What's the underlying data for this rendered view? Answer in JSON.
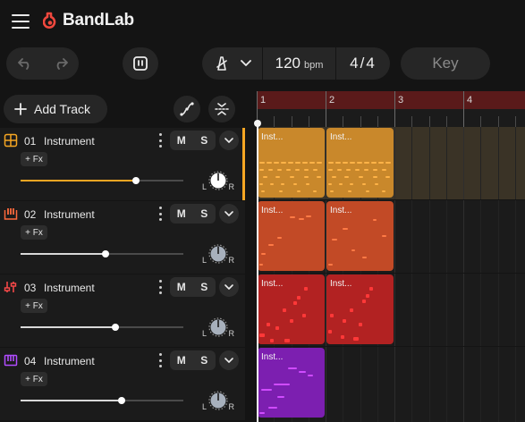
{
  "app": {
    "brand": "BandLab"
  },
  "toolbar": {
    "bpm_value": "120",
    "bpm_unit": "bpm",
    "time_signature": "4/4",
    "key_label": "Key",
    "add_track_label": "Add Track"
  },
  "ruler": {
    "bars": [
      "1",
      "2",
      "3",
      "4"
    ]
  },
  "tracks": [
    {
      "number": "01",
      "name": "Instrument",
      "mute": "M",
      "solo": "S",
      "fx": "+ Fx",
      "pan_left": "L",
      "pan_right": "R",
      "volume": 0.71,
      "color": "#f6a623",
      "icon": "drum-pad-icon",
      "selected": true
    },
    {
      "number": "02",
      "name": "Instrument",
      "mute": "M",
      "solo": "S",
      "fx": "+ Fx",
      "pan_left": "L",
      "pan_right": "R",
      "volume": 0.52,
      "color": "#ff6a3d",
      "icon": "piano-icon",
      "selected": false
    },
    {
      "number": "03",
      "name": "Instrument",
      "mute": "M",
      "solo": "S",
      "fx": "+ Fx",
      "pan_left": "L",
      "pan_right": "R",
      "volume": 0.58,
      "color": "#ff4a4a",
      "icon": "mixer-icon",
      "selected": false
    },
    {
      "number": "04",
      "name": "Instrument",
      "mute": "M",
      "solo": "S",
      "fx": "+ Fx",
      "pan_left": "L",
      "pan_right": "R",
      "volume": 0.62,
      "color": "#b14cff",
      "icon": "keyboard-icon",
      "selected": false
    }
  ],
  "clips": [
    {
      "title": "Inst...",
      "track": 0,
      "bar": 1
    },
    {
      "title": "Inst...",
      "track": 0,
      "bar": 2
    },
    {
      "title": "Inst...",
      "track": 1,
      "bar": 1
    },
    {
      "title": "Inst...",
      "track": 1,
      "bar": 2
    },
    {
      "title": "Inst...",
      "track": 2,
      "bar": 1
    },
    {
      "title": "Inst...",
      "track": 2,
      "bar": 2
    },
    {
      "title": "Inst...",
      "track": 3,
      "bar": 1
    }
  ],
  "colors": {
    "track1_clip": "#c9882b",
    "track2_clip": "#c24a26",
    "track3_clip": "#b22222",
    "track4_clip": "#7c1fb0",
    "loop_region": "#5a1a1a",
    "accent": "#f6a623"
  }
}
